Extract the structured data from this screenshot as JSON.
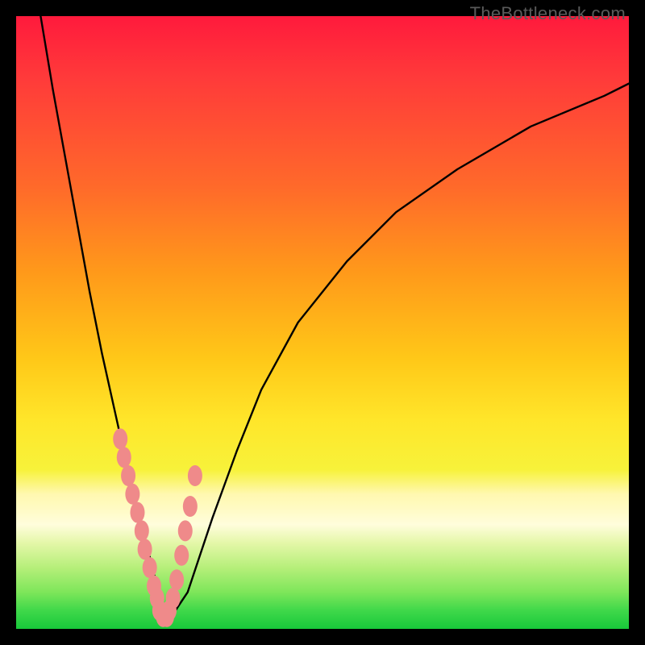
{
  "watermark": "TheBottleneck.com",
  "chart_data": {
    "type": "line",
    "title": "",
    "xlabel": "",
    "ylabel": "",
    "xlim": [
      0,
      100
    ],
    "ylim": [
      0,
      100
    ],
    "grid": false,
    "series": [
      {
        "name": "bottleneck-curve",
        "color": "#000000",
        "x": [
          4,
          6,
          8,
          10,
          12,
          14,
          16,
          18,
          19,
          20,
          21,
          22,
          23,
          24,
          25,
          26,
          28,
          30,
          32,
          36,
          40,
          46,
          54,
          62,
          72,
          84,
          96,
          100
        ],
        "y": [
          100,
          88,
          77,
          66,
          55,
          45,
          36,
          27,
          23,
          19,
          15,
          11,
          7,
          4,
          2,
          3,
          6,
          12,
          18,
          29,
          39,
          50,
          60,
          68,
          75,
          82,
          87,
          89
        ]
      }
    ],
    "markers": {
      "name": "highlight-points",
      "color": "#ef8a8a",
      "x": [
        17.0,
        17.6,
        18.3,
        19.0,
        19.8,
        20.5,
        21.0,
        21.8,
        22.5,
        23.0,
        23.4,
        24.0,
        24.6,
        25.0,
        25.6,
        26.2,
        27.0,
        27.6,
        28.4,
        29.2
      ],
      "y": [
        31,
        28,
        25,
        22,
        19,
        16,
        13,
        10,
        7,
        5,
        3,
        2,
        2,
        3,
        5,
        8,
        12,
        16,
        20,
        25
      ]
    },
    "annotations": []
  }
}
